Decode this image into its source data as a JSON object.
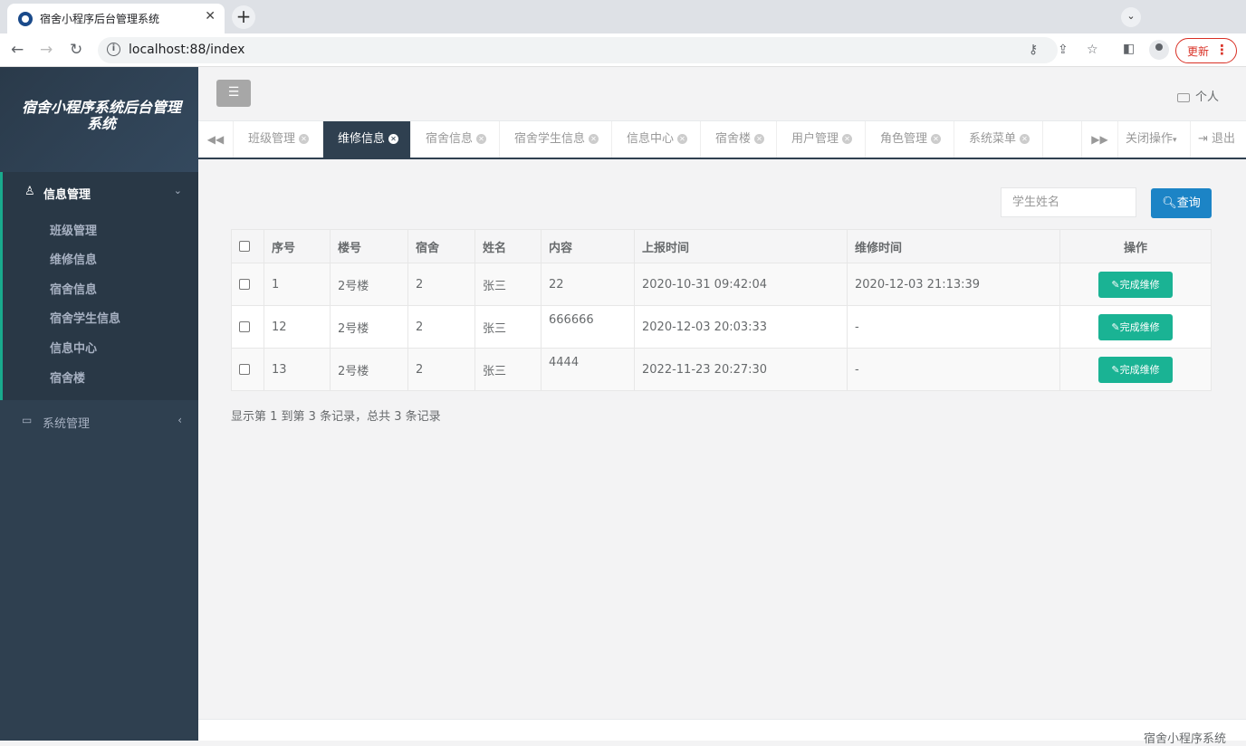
{
  "browser": {
    "tab_title": "宿舍小程序后台管理系统",
    "url": "localhost:88/index",
    "update_label": "更新"
  },
  "sidebar": {
    "brand_title": "宿舍小程序系统后台管理系统",
    "group1": {
      "label": "信息管理",
      "items": [
        "班级管理",
        "维修信息",
        "宿舍信息",
        "宿舍学生信息",
        "信息中心",
        "宿舍楼"
      ]
    },
    "group2": {
      "label": "系统管理"
    }
  },
  "header": {
    "personal_label": "个人"
  },
  "tabs": {
    "items": [
      {
        "label": "班级管理"
      },
      {
        "label": "维修信息"
      },
      {
        "label": "宿舍信息"
      },
      {
        "label": "宿舍学生信息"
      },
      {
        "label": "信息中心"
      },
      {
        "label": "宿舍楼"
      },
      {
        "label": "用户管理"
      },
      {
        "label": "角色管理"
      },
      {
        "label": "系统菜单"
      }
    ],
    "active_index": 1,
    "close_ops_label": "关闭操作",
    "logout_label": "退出"
  },
  "search": {
    "placeholder": "学生姓名",
    "button_label": "查询"
  },
  "table": {
    "columns": [
      "序号",
      "楼号",
      "宿舍",
      "姓名",
      "内容",
      "上报时间",
      "维修时间",
      "操作"
    ],
    "rows": [
      {
        "id": "1",
        "building": "2号楼",
        "dorm": "2",
        "name": "张三",
        "content": "22",
        "report_time": "2020-10-31 09:42:04",
        "repair_time": "2020-12-03 21:13:39",
        "action": "完成维修"
      },
      {
        "id": "12",
        "building": "2号楼",
        "dorm": "2",
        "name": "张三",
        "content": "666666",
        "report_time": "2020-12-03 20:03:33",
        "repair_time": "-",
        "action": "完成维修"
      },
      {
        "id": "13",
        "building": "2号楼",
        "dorm": "2",
        "name": "张三",
        "content": "4444",
        "report_time": "2022-11-23 20:27:30",
        "repair_time": "-",
        "action": "完成维修"
      }
    ]
  },
  "pager": {
    "text": "显示第 1 到第 3 条记录，总共 3 条记录"
  },
  "footer": {
    "text": "宿舍小程序系统"
  },
  "colors": {
    "sidebar_bg": "#2f4050",
    "accent_green": "#1ab394",
    "primary_blue": "#1c84c6"
  }
}
